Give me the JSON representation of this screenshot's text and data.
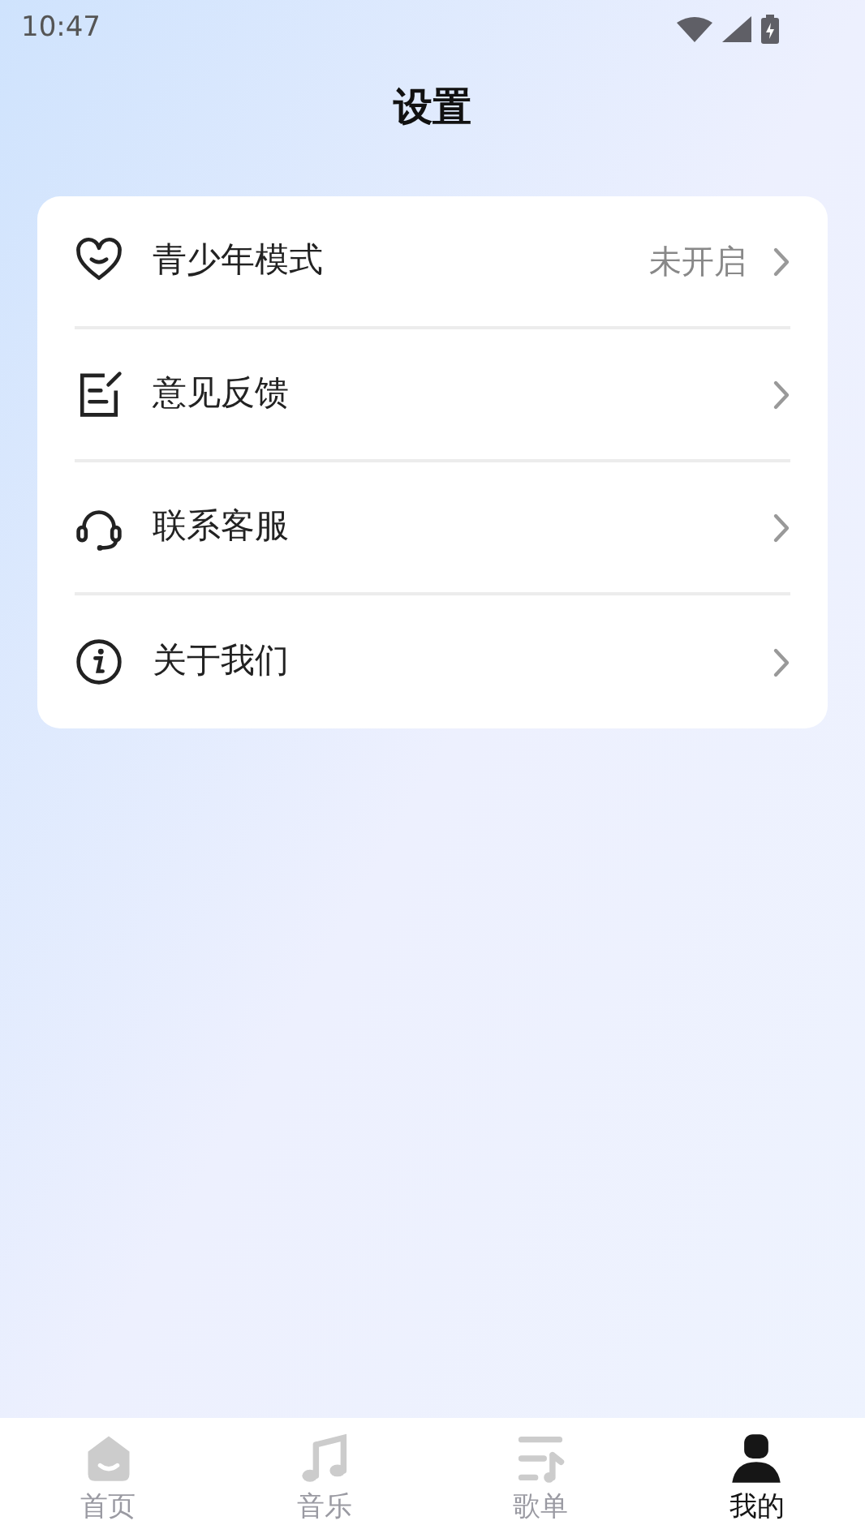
{
  "status_bar": {
    "time": "10:47"
  },
  "title": "设置",
  "settings": [
    {
      "kind": "heart",
      "label": "青少年模式",
      "value": "未开启"
    },
    {
      "kind": "note",
      "label": "意见反馈"
    },
    {
      "kind": "headset",
      "label": "联系客服"
    },
    {
      "kind": "info",
      "label": "关于我们"
    }
  ],
  "tabs": [
    {
      "kind": "home",
      "label": "首页",
      "selected": false
    },
    {
      "kind": "music",
      "label": "音乐",
      "selected": false
    },
    {
      "kind": "playlist",
      "label": "歌单",
      "selected": false
    },
    {
      "kind": "user",
      "label": "我的",
      "selected": true
    }
  ]
}
